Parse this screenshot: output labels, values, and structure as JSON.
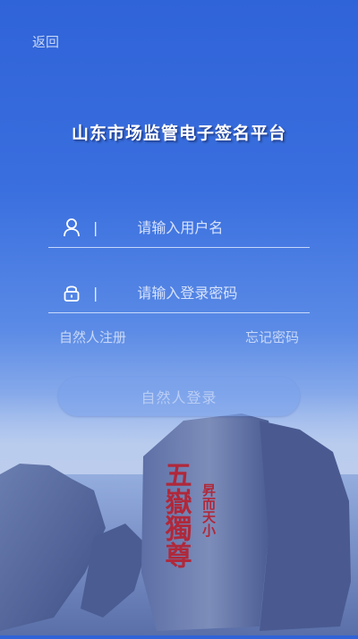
{
  "header": {
    "back_label": "返回"
  },
  "title": "山东市场监管电子签名平台",
  "form": {
    "username": {
      "placeholder": "请输入用户名",
      "icon": "user-icon",
      "separator": "|"
    },
    "password": {
      "placeholder": "请输入登录密码",
      "icon": "lock-icon",
      "separator": "|"
    }
  },
  "links": {
    "register": "自然人注册",
    "forgot": "忘记密码"
  },
  "login_button": "自然人登录",
  "background": {
    "stele_big": "五嶽獨尊",
    "stele_small": "昇而天小"
  },
  "colors": {
    "primary": "#2f63d8",
    "button": "#78a0eb"
  }
}
